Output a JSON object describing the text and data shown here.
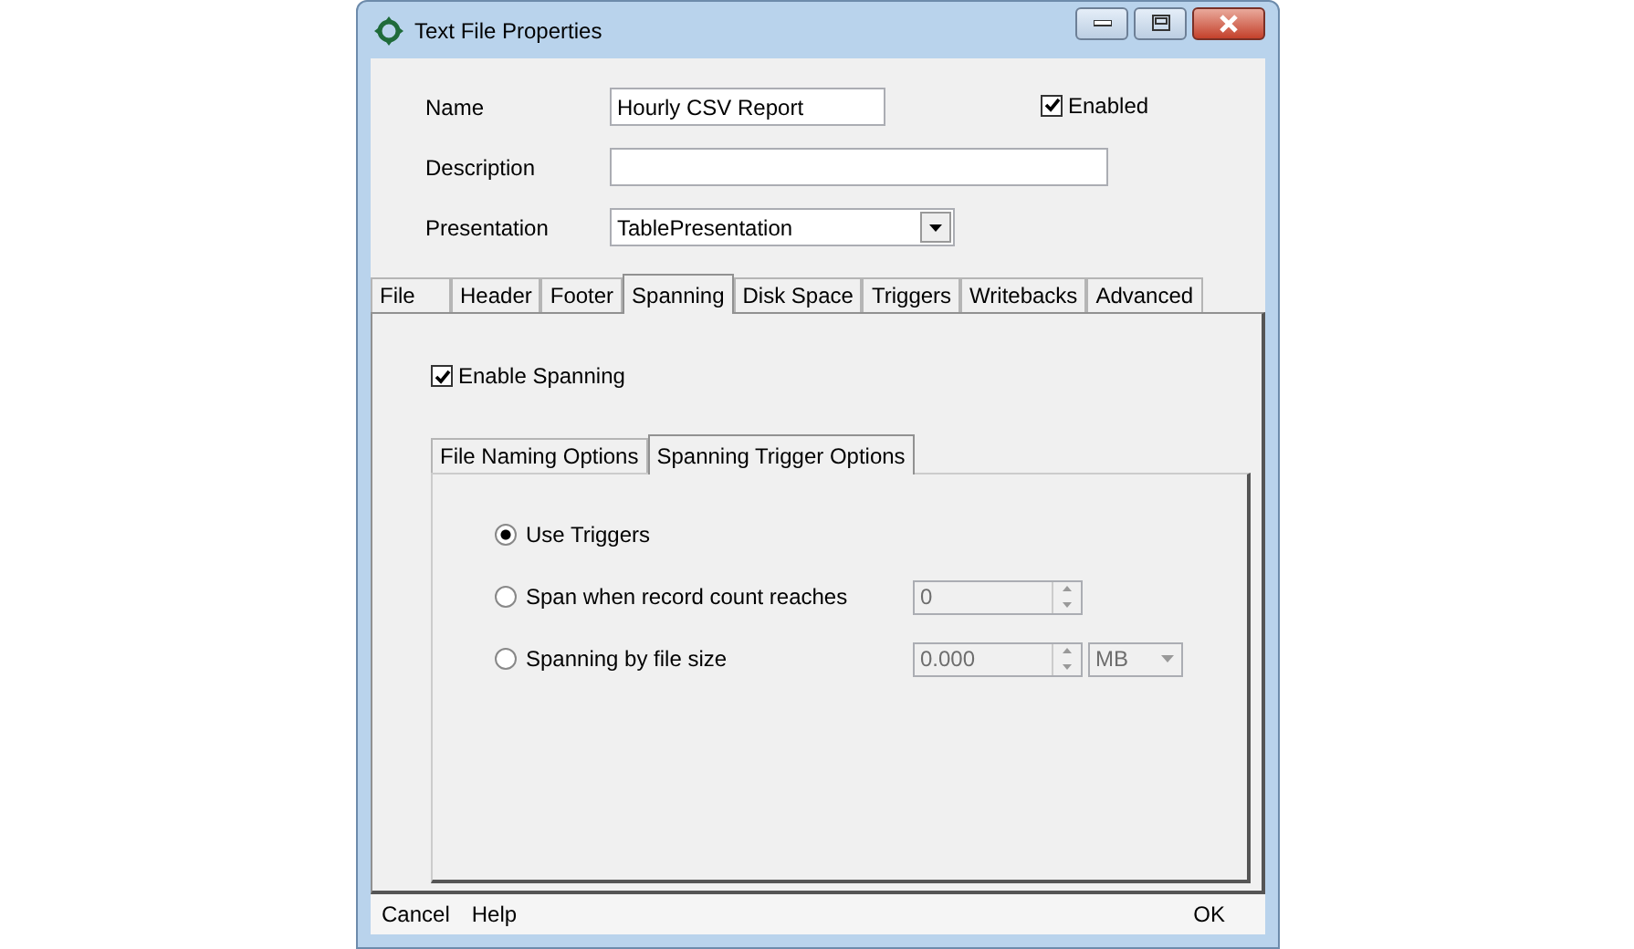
{
  "window": {
    "title": "Text File Properties"
  },
  "form": {
    "name": {
      "label": "Name",
      "value": "Hourly CSV Report"
    },
    "enabled": {
      "label": "Enabled",
      "checked": true
    },
    "description": {
      "label": "Description"
    },
    "presentation": {
      "label": "Presentation",
      "value": "TablePresentation"
    }
  },
  "tabs": [
    {
      "label": "File",
      "selected": false
    },
    {
      "label": "Header",
      "selected": false
    },
    {
      "label": "Footer",
      "selected": false
    },
    {
      "label": "Spanning",
      "selected": true
    },
    {
      "label": "Disk Space",
      "selected": false
    },
    {
      "label": "Triggers",
      "selected": false
    },
    {
      "label": "Writebacks",
      "selected": false
    },
    {
      "label": "Advanced",
      "selected": false
    }
  ],
  "enable_spanning": {
    "label": "Enable Spanning",
    "checked": true
  },
  "inner_tabs": [
    {
      "label": "File Naming Options",
      "selected": false
    },
    {
      "label": "Spanning Trigger Options",
      "selected": true
    }
  ],
  "trigger_options": [
    {
      "kind": "plain",
      "label": "Use Triggers",
      "selected": true
    },
    {
      "kind": "count",
      "label": "Span when record count reaches",
      "selected": false,
      "value": "0",
      "disabled": true
    },
    {
      "kind": "size",
      "label": "Spanning by file size",
      "selected": false,
      "value": "0.000",
      "unit": "MB",
      "disabled": true
    }
  ],
  "footer": {
    "left": [
      "Cancel",
      "Help"
    ],
    "right": [
      "OK"
    ]
  }
}
